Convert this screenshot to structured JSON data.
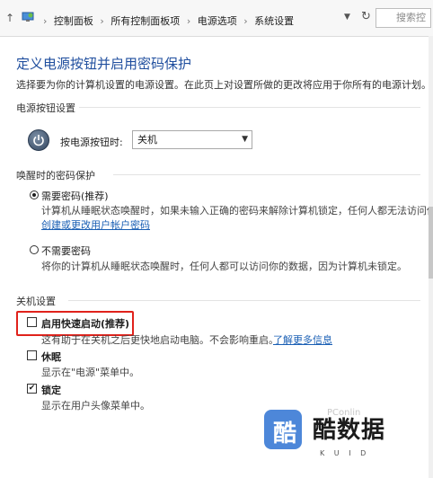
{
  "breadcrumb": {
    "items": [
      "控制面板",
      "所有控制面板项",
      "电源选项",
      "系统设置"
    ],
    "separator": "›"
  },
  "search": {
    "placeholder": "搜索控"
  },
  "page": {
    "title": "定义电源按钮并启用密码保护",
    "description": "选择要为你的计算机设置的电源设置。在此页上对设置所做的更改将应用于你所有的电源计划。"
  },
  "power_section": {
    "heading": "电源按钮设置",
    "label": "按电源按钮时:",
    "selected": "关机"
  },
  "wake_section": {
    "heading": "唤醒时的密码保护",
    "options": [
      {
        "label": "需要密码(推荐)",
        "selected": true,
        "description": "计算机从睡眠状态唤醒时，如果未输入正确的密码来解除计算机锁定，任何人都无法访问你的",
        "link": "创建或更改用户帐户密码"
      },
      {
        "label": "不需要密码",
        "selected": false,
        "description": "将你的计算机从睡眠状态唤醒时，任何人都可以访问你的数据，因为计算机未锁定。"
      }
    ]
  },
  "shutdown_section": {
    "heading": "关机设置",
    "fast_startup": {
      "label": "启用快速启动(推荐)",
      "checked": false,
      "description": "这有助于在关机之后更快地启动电脑。不会影响重启。",
      "link": "了解更多信息"
    },
    "hibernate": {
      "label": "休眠",
      "checked": false,
      "description": "显示在\"电源\"菜单中。"
    },
    "lock": {
      "label": "锁定",
      "checked": true,
      "description": "显示在用户头像菜单中。"
    }
  },
  "watermark": {
    "word": "酷数据",
    "pinyin": "K U I D",
    "faint": "PConlin"
  },
  "colors": {
    "title": "#1f4e9e",
    "link": "#1a5fb4",
    "highlight_box": "#e0221b"
  }
}
